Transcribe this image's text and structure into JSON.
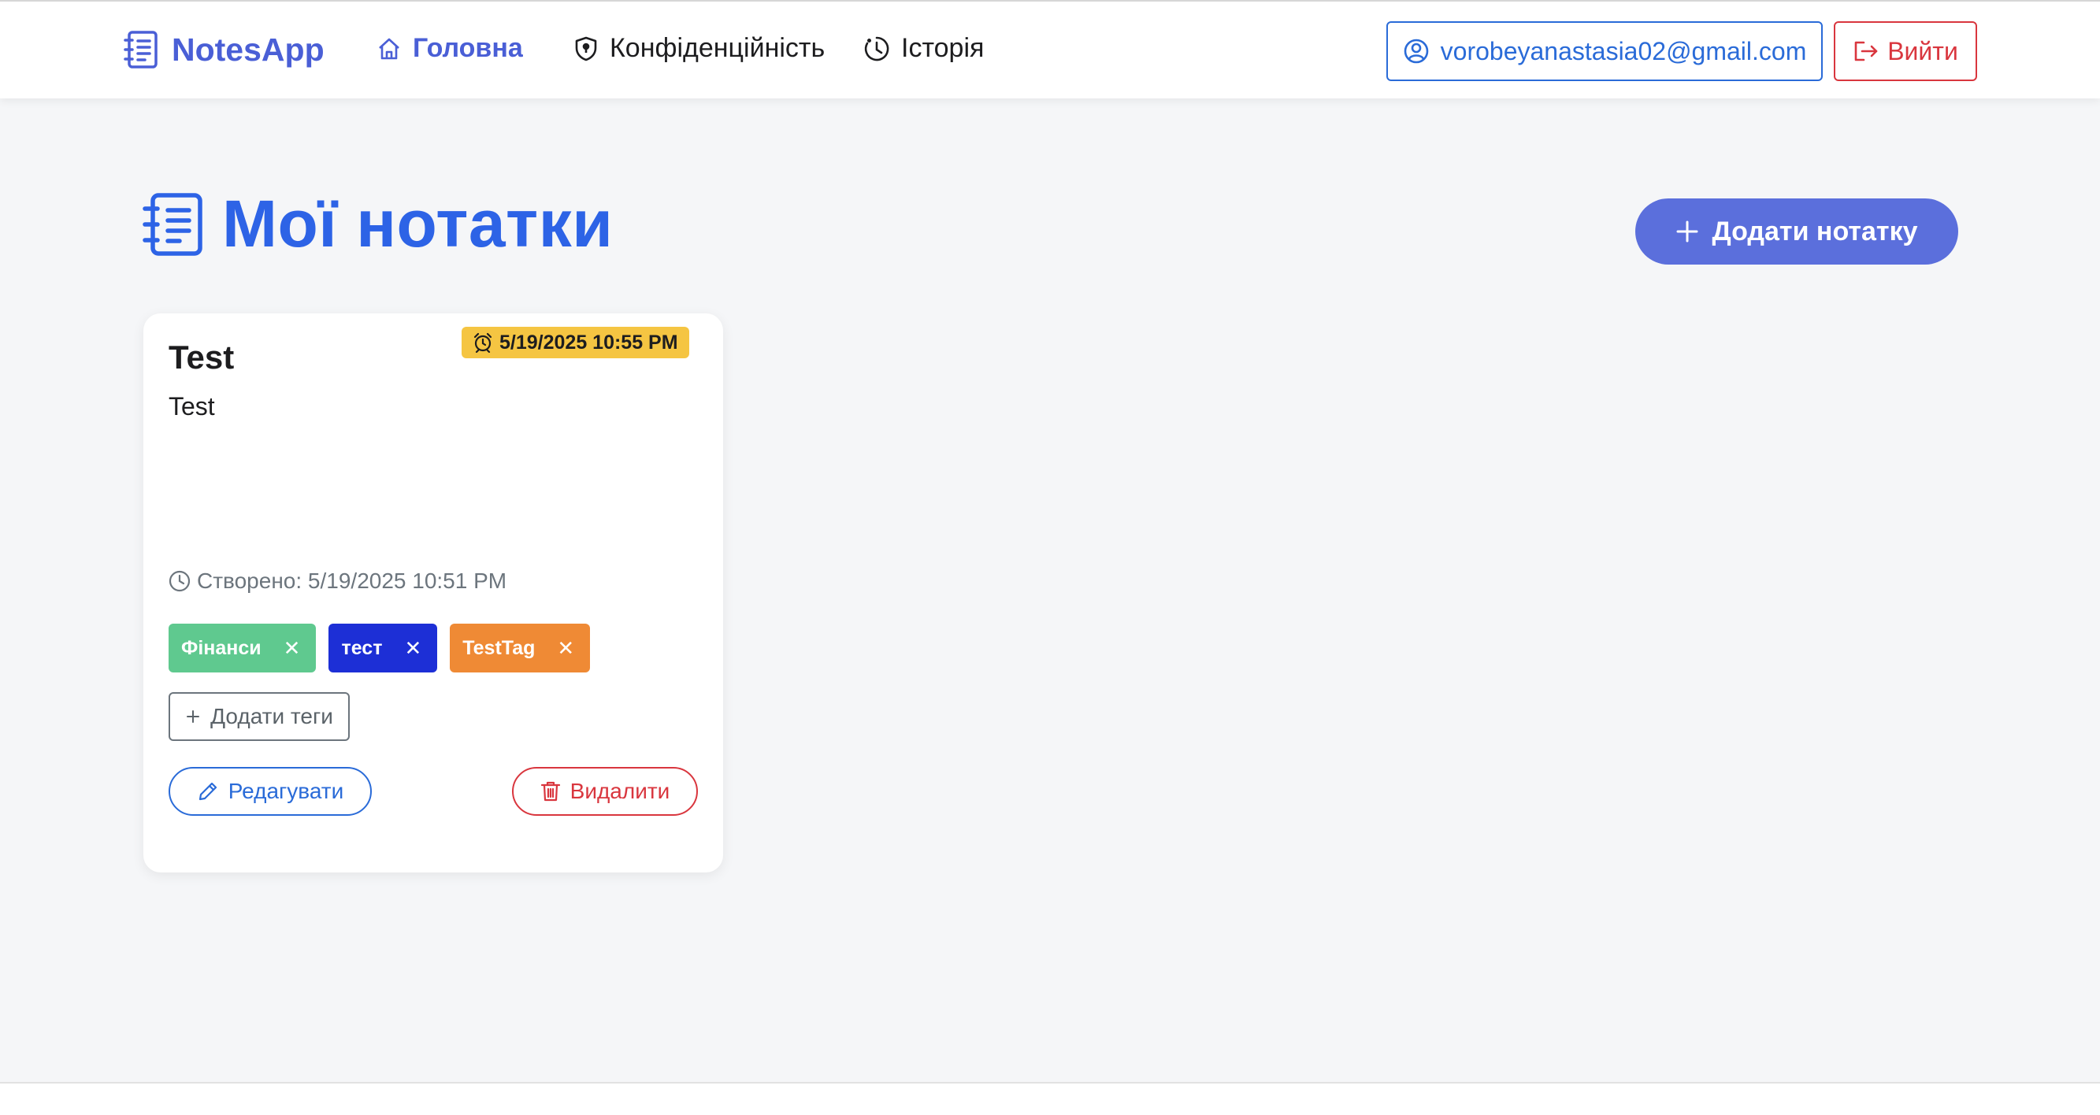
{
  "header": {
    "brand": "NotesApp",
    "nav": [
      {
        "label": "Головна",
        "icon": "home-icon",
        "active": true
      },
      {
        "label": "Конфіденційність",
        "icon": "shield-icon",
        "active": false
      },
      {
        "label": "Історія",
        "icon": "clock-icon",
        "active": false
      }
    ],
    "user_email": "vorobeyanastasia02@gmail.com",
    "logout_label": "Вийти"
  },
  "main": {
    "title": "Мої нотатки",
    "add_note_label": "Додати нотатку"
  },
  "note": {
    "title": "Test",
    "reminder": "5/19/2025 10:55 PM",
    "body": "Test",
    "created": "Створено: 5/19/2025 10:51 PM",
    "tags": [
      {
        "label": "Фінанси",
        "color": "#5fc98f"
      },
      {
        "label": "тест",
        "color": "#1d2fd6"
      },
      {
        "label": "TestTag",
        "color": "#ef8a35"
      }
    ],
    "add_tags_label": "Додати теги",
    "edit_label": "Редагувати",
    "delete_label": "Видалити"
  },
  "colors": {
    "accent": "#4a5fd6",
    "title_blue": "#2d63e6",
    "danger": "#d9363e",
    "reminder_badge": "#f5c542"
  }
}
